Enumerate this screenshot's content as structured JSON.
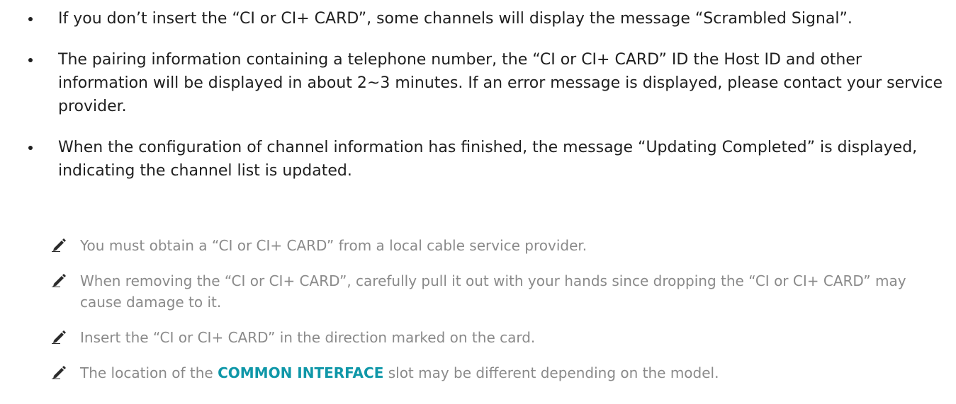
{
  "bullets": [
    "If you don’t insert the “CI or CI+ CARD”, some channels will display the message “Scrambled Signal”.",
    "The pairing information containing a telephone number, the “CI or CI+ CARD” ID the Host ID and other information will be displayed in about 2~3 minutes. If an error message is displayed, please contact your service provider.",
    "When the configuration of channel information has finished, the message “Updating Completed” is displayed, indicating the channel list is updated."
  ],
  "notes": [
    {
      "text": "You must obtain a “CI or CI+ CARD” from a local cable service provider."
    },
    {
      "text": "When removing the “CI or CI+ CARD”, carefully pull it out with your hands since dropping the “CI or CI+ CARD” may cause damage to it."
    },
    {
      "text": "Insert the “CI or CI+ CARD” in the direction marked on the card."
    },
    {
      "before": "The location of the ",
      "highlight": "COMMON INTERFACE",
      "after": " slot may be different depending on the model."
    }
  ],
  "icons": {
    "bullet": "bullet-dot-icon",
    "note": "pencil-note-icon"
  },
  "colors": {
    "body_text": "#1f1f1f",
    "note_text": "#8a8a8a",
    "highlight": "#0f97a8"
  }
}
